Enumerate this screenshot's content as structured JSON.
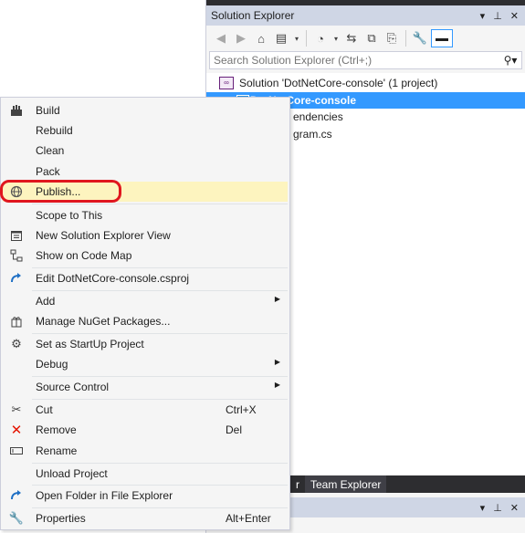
{
  "solution_explorer": {
    "title": "Solution Explorer",
    "title_buttons": [
      "▾",
      "⊥",
      "✕"
    ],
    "search_placeholder": "Search Solution Explorer (Ctrl+;)",
    "search_icon": "search-icon",
    "tree": {
      "solution_label": "Solution 'DotNetCore-console' (1 project)",
      "project_label": "DotNetCore-console",
      "dependencies_label": "endencies",
      "program_label": "gram.cs"
    },
    "tabs": [
      "r",
      "Team Explorer"
    ],
    "bottom_title_buttons": [
      "▾",
      "⊥",
      "✕"
    ],
    "colors": {
      "accent": "#3399ff",
      "title_bar": "#cfd6e5",
      "dark": "#2d2d30"
    }
  },
  "context_menu": {
    "items": {
      "build": "Build",
      "rebuild": "Rebuild",
      "clean": "Clean",
      "pack": "Pack",
      "publish": "Publish...",
      "scope": "Scope to This",
      "new_view": "New Solution Explorer View",
      "code_map": "Show on Code Map",
      "edit_proj": "Edit DotNetCore-console.csproj",
      "add": "Add",
      "nuget": "Manage NuGet Packages...",
      "startup": "Set as StartUp Project",
      "debug": "Debug",
      "source_control": "Source Control",
      "cut": "Cut",
      "remove": "Remove",
      "rename": "Rename",
      "unload": "Unload Project",
      "open_folder": "Open Folder in File Explorer",
      "properties": "Properties"
    },
    "shortcuts": {
      "cut": "Ctrl+X",
      "remove": "Del",
      "properties": "Alt+Enter"
    },
    "highlight_color": "#fdf4bf",
    "annotation_color": "#e0161e"
  }
}
